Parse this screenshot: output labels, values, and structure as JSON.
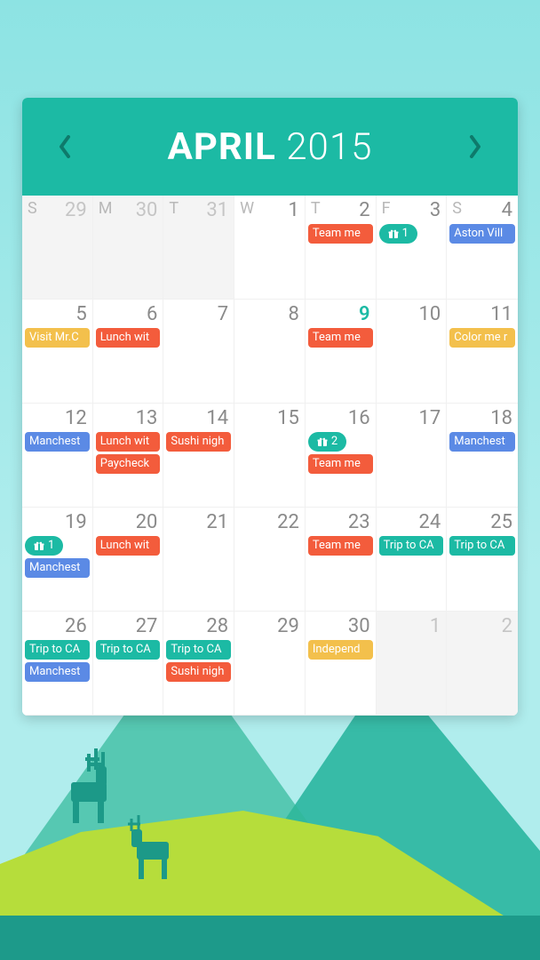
{
  "header": {
    "month": "APRIL",
    "year": "2015"
  },
  "dow": [
    "S",
    "M",
    "T",
    "W",
    "T",
    "F",
    "S"
  ],
  "cells": [
    {
      "day": "29",
      "prev": true,
      "events": []
    },
    {
      "day": "30",
      "prev": true,
      "events": []
    },
    {
      "day": "31",
      "prev": true,
      "events": []
    },
    {
      "day": "1",
      "events": []
    },
    {
      "day": "2",
      "events": [
        {
          "label": "Team me",
          "color": "orange"
        }
      ]
    },
    {
      "day": "3",
      "events": [
        {
          "label": "1",
          "color": "teal",
          "pill": true,
          "icon": "gift"
        }
      ]
    },
    {
      "day": "4",
      "events": [
        {
          "label": "Aston Vill",
          "color": "blue"
        }
      ]
    },
    {
      "day": "5",
      "events": [
        {
          "label": "Visit Mr.C",
          "color": "gold"
        }
      ]
    },
    {
      "day": "6",
      "events": [
        {
          "label": "Lunch wit",
          "color": "orange"
        }
      ]
    },
    {
      "day": "7",
      "events": []
    },
    {
      "day": "8",
      "events": []
    },
    {
      "day": "9",
      "today": true,
      "events": [
        {
          "label": "Team me",
          "color": "orange"
        }
      ]
    },
    {
      "day": "10",
      "events": []
    },
    {
      "day": "11",
      "events": [
        {
          "label": "Color me r",
          "color": "gold"
        }
      ]
    },
    {
      "day": "12",
      "events": [
        {
          "label": "Manchest",
          "color": "blue"
        }
      ]
    },
    {
      "day": "13",
      "events": [
        {
          "label": "Lunch wit",
          "color": "orange"
        },
        {
          "label": "Paycheck",
          "color": "orange"
        }
      ]
    },
    {
      "day": "14",
      "events": [
        {
          "label": "Sushi nigh",
          "color": "orange"
        }
      ]
    },
    {
      "day": "15",
      "events": []
    },
    {
      "day": "16",
      "events": [
        {
          "label": "2",
          "color": "teal",
          "pill": true,
          "icon": "gift"
        },
        {
          "label": "Team me",
          "color": "orange"
        }
      ]
    },
    {
      "day": "17",
      "events": []
    },
    {
      "day": "18",
      "events": [
        {
          "label": "Manchest",
          "color": "blue"
        }
      ]
    },
    {
      "day": "19",
      "events": [
        {
          "label": "1",
          "color": "teal",
          "pill": true,
          "icon": "gift"
        },
        {
          "label": "Manchest",
          "color": "blue"
        }
      ]
    },
    {
      "day": "20",
      "events": [
        {
          "label": "Lunch wit",
          "color": "orange"
        }
      ]
    },
    {
      "day": "21",
      "events": []
    },
    {
      "day": "22",
      "events": []
    },
    {
      "day": "23",
      "events": [
        {
          "label": "Team me",
          "color": "orange"
        }
      ]
    },
    {
      "day": "24",
      "events": [
        {
          "label": "Trip to CA",
          "color": "teal"
        }
      ]
    },
    {
      "day": "25",
      "events": [
        {
          "label": "Trip to CA",
          "color": "teal"
        }
      ]
    },
    {
      "day": "26",
      "events": [
        {
          "label": "Trip to CA",
          "color": "teal"
        },
        {
          "label": "Manchest",
          "color": "blue"
        }
      ]
    },
    {
      "day": "27",
      "events": [
        {
          "label": "Trip to CA",
          "color": "teal"
        }
      ]
    },
    {
      "day": "28",
      "events": [
        {
          "label": "Trip to CA",
          "color": "teal"
        },
        {
          "label": "Sushi nigh",
          "color": "orange"
        }
      ]
    },
    {
      "day": "29",
      "events": []
    },
    {
      "day": "30",
      "events": [
        {
          "label": "Independ",
          "color": "gold"
        }
      ]
    },
    {
      "day": "1",
      "next": true,
      "events": []
    },
    {
      "day": "2",
      "next": true,
      "events": []
    }
  ]
}
